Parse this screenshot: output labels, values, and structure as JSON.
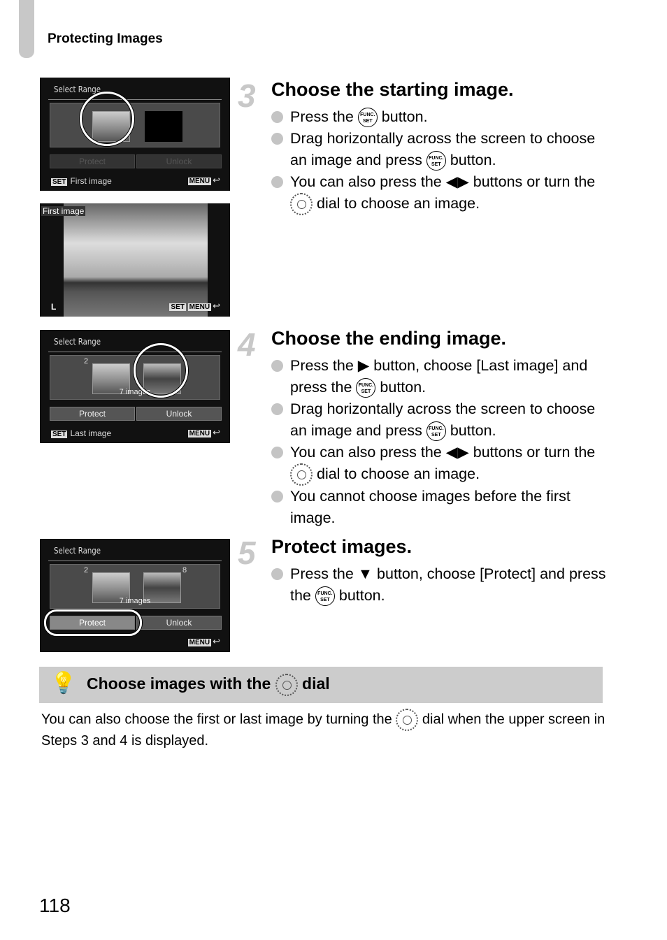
{
  "header": {
    "section_title": "Protecting Images"
  },
  "screens": {
    "s1": {
      "title": "Select Range",
      "protect": "Protect",
      "unlock": "Unlock",
      "set": "SET",
      "footer": "First image",
      "menu": "MENU"
    },
    "s2": {
      "label": "First image",
      "set": "SET",
      "menu": "MENU",
      "size": "L"
    },
    "s3": {
      "title": "Select Range",
      "first_num": "2",
      "count": "7 images",
      "protect": "Protect",
      "unlock": "Unlock",
      "set": "SET",
      "footer": "Last image",
      "menu": "MENU"
    },
    "s4": {
      "title": "Select Range",
      "first_num": "2",
      "last_num": "8",
      "count": "7 images",
      "protect": "Protect",
      "unlock": "Unlock",
      "menu": "MENU"
    }
  },
  "steps": [
    {
      "number": "3",
      "title": "Choose the starting image.",
      "b1a": "Press the",
      "b1b": "button.",
      "b2a": "Drag horizontally across the screen to choose an image and press",
      "b2b": "button.",
      "b3a": "You can also press the ◀▶ buttons or turn the",
      "b3b": "dial to choose an image."
    },
    {
      "number": "4",
      "title": "Choose the ending image.",
      "b1a": "Press the ▶ button, choose [Last image] and press the",
      "b1b": "button.",
      "b2a": "Drag horizontally across the screen to choose an image and press",
      "b2b": "button.",
      "b3a": "You can also press the ◀▶ buttons or turn the",
      "b3b": "dial to choose an image.",
      "b4": "You cannot choose images before the first image."
    },
    {
      "number": "5",
      "title": "Protect images.",
      "b1a": "Press the ▼ button, choose [Protect] and press the",
      "b1b": "button."
    }
  ],
  "func_label": "FUNC. SET",
  "tip": {
    "title_a": "Choose images with the",
    "title_b": "dial",
    "body_a": "You can also choose the first or last image by turning the",
    "body_b": "dial when the upper screen in Steps 3 and 4 is displayed."
  },
  "page_number": "118"
}
